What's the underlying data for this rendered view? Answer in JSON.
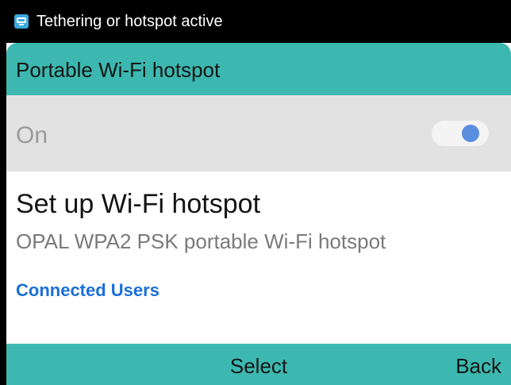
{
  "status_bar": {
    "icon": "hotspot-notification-icon",
    "text": "Tethering or hotspot active"
  },
  "header": {
    "title": "Portable Wi-Fi hotspot"
  },
  "hotspot_toggle": {
    "label": "On",
    "state": "on",
    "accent_color": "#5a8fe0"
  },
  "setup": {
    "title": "Set up Wi-Fi hotspot",
    "subtitle": "OPAL WPA2 PSK portable Wi-Fi hotspot"
  },
  "connected_users": {
    "label": "Connected Users"
  },
  "softkeys": {
    "center": "Select",
    "right": "Back"
  },
  "colors": {
    "header_bg": "#3cb8b0",
    "link": "#1a6fd6",
    "selected_row_bg": "#e2e2e2"
  }
}
